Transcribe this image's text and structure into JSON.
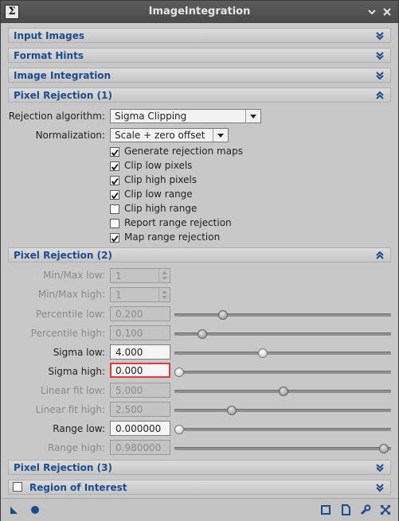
{
  "window": {
    "title": "ImageIntegration"
  },
  "sections": {
    "input_images": "Input Images",
    "format_hints": "Format Hints",
    "image_integration": "Image Integration",
    "pixel_rejection_1": "Pixel Rejection (1)",
    "pixel_rejection_2": "Pixel Rejection (2)",
    "pixel_rejection_3": "Pixel Rejection (3)",
    "region_of_interest": "Region of Interest"
  },
  "pr1": {
    "rejection_algorithm_label": "Rejection algorithm:",
    "rejection_algorithm_value": "Sigma Clipping",
    "normalization_label": "Normalization:",
    "normalization_value": "Scale + zero offset",
    "checkboxes": [
      {
        "label": "Generate rejection maps",
        "checked": true
      },
      {
        "label": "Clip low pixels",
        "checked": true
      },
      {
        "label": "Clip high pixels",
        "checked": true
      },
      {
        "label": "Clip low range",
        "checked": true
      },
      {
        "label": "Clip high range",
        "checked": false
      },
      {
        "label": "Report range rejection",
        "checked": false
      },
      {
        "label": "Map range rejection",
        "checked": true
      }
    ]
  },
  "pr2": {
    "minmax_low_label": "Min/Max low:",
    "minmax_low_value": "1",
    "minmax_high_label": "Min/Max high:",
    "minmax_high_value": "1",
    "percentile_low_label": "Percentile low:",
    "percentile_low_value": "0.200",
    "percentile_high_label": "Percentile high:",
    "percentile_high_value": "0.100",
    "sigma_low_label": "Sigma low:",
    "sigma_low_value": "4.000",
    "sigma_high_label": "Sigma high:",
    "sigma_high_value": "0.000",
    "linear_fit_low_label": "Linear fit low:",
    "linear_fit_low_value": "5.000",
    "linear_fit_high_label": "Linear fit high:",
    "linear_fit_high_value": "2.500",
    "range_low_label": "Range low:",
    "range_low_value": "0.000000",
    "range_high_label": "Range high:",
    "range_high_value": "0.980000"
  },
  "sliders": {
    "percentile_low": 0.21,
    "percentile_high": 0.11,
    "sigma_low": 0.4,
    "sigma_high": 0.0,
    "linear_fit_low": 0.5,
    "linear_fit_high": 0.25,
    "range_low": 0.0,
    "range_high": 0.98
  },
  "colors": {
    "section_text": "#1b4c90",
    "focus_border": "#e03a3a",
    "accent_icon": "#1b4c90"
  },
  "icons": {
    "app": "sigma-icon",
    "title_buttons": [
      "shade-icon",
      "close-icon"
    ],
    "bottom_left": [
      "new-instance-triangle-icon",
      "apply-global-circle-icon"
    ],
    "bottom_right": [
      "browse-documentation-icon",
      "edit-instance-icon",
      "preferences-wrench-icon",
      "reset-icon"
    ]
  }
}
